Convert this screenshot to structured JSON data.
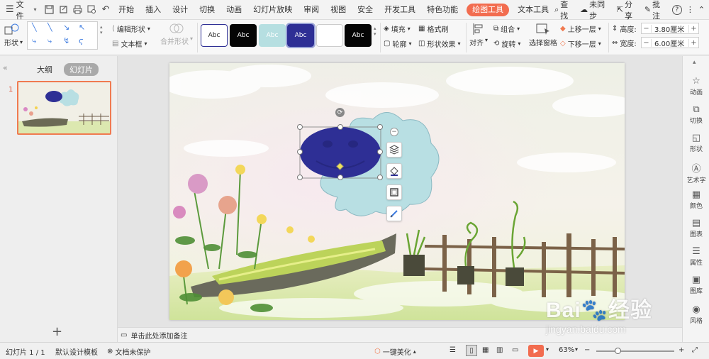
{
  "menubar": {
    "file_label": "文件",
    "tabs": [
      "开始",
      "插入",
      "设计",
      "切换",
      "动画",
      "幻灯片放映",
      "审阅",
      "视图",
      "安全",
      "开发工具",
      "特色功能",
      "绘图工具",
      "文本工具"
    ],
    "active_tab": "绘图工具",
    "search_label": "查找",
    "sync_label": "未同步",
    "share_label": "分享",
    "comment_label": "批注"
  },
  "ribbon": {
    "shape_label": "形状",
    "edit_shape_label": "编辑形状",
    "textbox_label": "文本框",
    "merge_shape_label": "合并形状",
    "style_preview": [
      "Abc",
      "Abc",
      "Abc",
      "Abc",
      "",
      "Abc"
    ],
    "fill_label": "填充",
    "format_brush_label": "格式刷",
    "outline_label": "轮廓",
    "shape_effect_label": "形状效果",
    "align_label": "对齐",
    "group_label": "组合",
    "rotate_label": "旋转",
    "selection_pane_label": "选择窗格",
    "bring_forward_label": "上移一层",
    "send_backward_label": "下移一层",
    "height_label": "高度:",
    "height_value": "3.80厘米",
    "width_label": "宽度:",
    "width_value": "6.00厘米"
  },
  "leftpanel": {
    "outline_tab": "大纲",
    "slides_tab": "幻灯片",
    "slide_number": "1"
  },
  "notes": {
    "placeholder": "单击此处添加备注"
  },
  "rightpanel": {
    "items": [
      "动画",
      "切换",
      "形状",
      "艺术字",
      "颜色",
      "图表",
      "属性",
      "图库",
      "风格"
    ]
  },
  "statusbar": {
    "slide_info": "幻灯片 1 / 1",
    "template": "默认设计模板",
    "doc_protect": "文档未保护",
    "beautify": "一键美化",
    "zoom": "63%"
  },
  "watermark": {
    "line1": "Bai",
    "line2": "经验",
    "url": "jingyan.baidu.com"
  },
  "colors": {
    "accent": "#f26c4f",
    "oval_fill": "#2e2f95",
    "cloud_fill": "#b8dfe3",
    "style_teal": "#b6dfe1",
    "style_navy": "#2e2f95"
  }
}
